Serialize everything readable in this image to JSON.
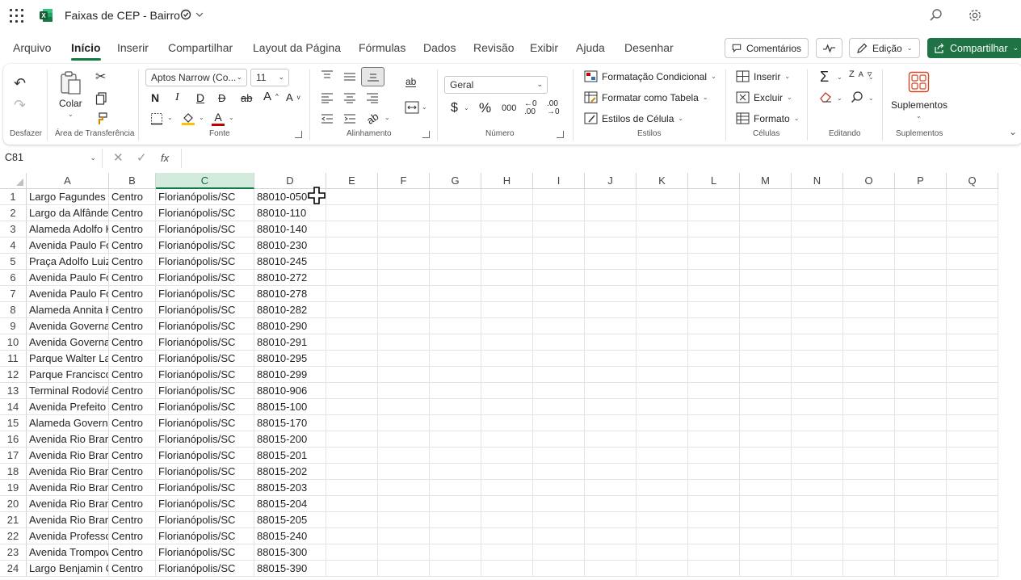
{
  "title_bar": {
    "doc_title": "Faixas de CEP - Bairro",
    "icons": [
      "app-launcher-icon",
      "excel-logo-icon",
      "autosave-icon",
      "chevron-down-icon",
      "search-icon",
      "gear-icon"
    ]
  },
  "menu": {
    "tabs": [
      "Arquivo",
      "Início",
      "Inserir",
      "Compartilhar",
      "Layout da Página",
      "Fórmulas",
      "Dados",
      "Revisão",
      "Exibir",
      "Ajuda",
      "Desenhar"
    ],
    "active_tab": "Início",
    "comments_label": "Comentários",
    "editing_label": "Edição",
    "share_label": "Compartilhar",
    "accent_color": "#107c41",
    "share_color": "#1f7244"
  },
  "ribbon": {
    "undo_group_label": "Desfazer",
    "clipboard": {
      "paste_label": "Colar",
      "group_label": "Área de Transferência"
    },
    "font": {
      "name": "Aptos Narrow (Co...",
      "size": "11",
      "bold": "N",
      "italic": "I",
      "underline": "D",
      "strike": "ab",
      "grow": "A",
      "shrink": "A",
      "font_color_letter": "A",
      "group_label": "Fonte"
    },
    "alignment": {
      "group_label": "Alinhamento"
    },
    "number": {
      "format": "Geral",
      "currency": "$",
      "percent": "%",
      "thousands": "000",
      "group_label": "Número"
    },
    "styles": {
      "conditional": "Formatação Condicional",
      "table": "Formatar como Tabela",
      "cell_styles": "Estilos de Célula",
      "group_label": "Estilos"
    },
    "cells": {
      "insert": "Inserir",
      "delete": "Excluir",
      "format": "Formato",
      "group_label": "Células"
    },
    "editing": {
      "group_label": "Editando"
    },
    "addins": {
      "button_label": "Suplementos",
      "group_label": "Suplementos"
    }
  },
  "formula_bar": {
    "name_box": "C81",
    "fx_label": "fx",
    "formula": ""
  },
  "grid": {
    "columns": [
      "A",
      "B",
      "C",
      "D",
      "E",
      "F",
      "G",
      "H",
      "I",
      "J",
      "K",
      "L",
      "M",
      "N",
      "O",
      "P",
      "Q"
    ],
    "selected_column": "C",
    "rows": [
      {
        "n": "1",
        "a": "Largo Fagundes",
        "b": "Centro",
        "c": "Florianópolis/SC",
        "d": "88010-050"
      },
      {
        "n": "2",
        "a": "Largo da Alfândega",
        "b": "Centro",
        "c": "Florianópolis/SC",
        "d": "88010-110"
      },
      {
        "n": "3",
        "a": "Alameda Adolfo Konder",
        "b": "Centro",
        "c": "Florianópolis/SC",
        "d": "88010-140"
      },
      {
        "n": "4",
        "a": "Avenida Paulo Fontes",
        "b": "Centro",
        "c": "Florianópolis/SC",
        "d": "88010-230"
      },
      {
        "n": "5",
        "a": "Praça Adolfo Luiz",
        "b": "Centro",
        "c": "Florianópolis/SC",
        "d": "88010-245"
      },
      {
        "n": "6",
        "a": "Avenida Paulo Fontes",
        "b": "Centro",
        "c": "Florianópolis/SC",
        "d": "88010-272"
      },
      {
        "n": "7",
        "a": "Avenida Paulo Fontes",
        "b": "Centro",
        "c": "Florianópolis/SC",
        "d": "88010-278"
      },
      {
        "n": "8",
        "a": "Alameda Annita Konder",
        "b": "Centro",
        "c": "Florianópolis/SC",
        "d": "88010-282"
      },
      {
        "n": "9",
        "a": "Avenida Governador",
        "b": "Centro",
        "c": "Florianópolis/SC",
        "d": "88010-290"
      },
      {
        "n": "10",
        "a": "Avenida Governador",
        "b": "Centro",
        "c": "Florianópolis/SC",
        "d": "88010-291"
      },
      {
        "n": "11",
        "a": "Parque Walter Lange",
        "b": "Centro",
        "c": "Florianópolis/SC",
        "d": "88010-295"
      },
      {
        "n": "12",
        "a": "Parque Francisco",
        "b": "Centro",
        "c": "Florianópolis/SC",
        "d": "88010-299"
      },
      {
        "n": "13",
        "a": "Terminal Rodoviário",
        "b": "Centro",
        "c": "Florianópolis/SC",
        "d": "88010-906"
      },
      {
        "n": "14",
        "a": "Avenida Prefeito Osmar",
        "b": "Centro",
        "c": "Florianópolis/SC",
        "d": "88015-100"
      },
      {
        "n": "15",
        "a": "Alameda Governador",
        "b": "Centro",
        "c": "Florianópolis/SC",
        "d": "88015-170"
      },
      {
        "n": "16",
        "a": "Avenida Rio Branco",
        "b": "Centro",
        "c": "Florianópolis/SC",
        "d": "88015-200"
      },
      {
        "n": "17",
        "a": "Avenida Rio Branco",
        "b": "Centro",
        "c": "Florianópolis/SC",
        "d": "88015-201"
      },
      {
        "n": "18",
        "a": "Avenida Rio Branco",
        "b": "Centro",
        "c": "Florianópolis/SC",
        "d": "88015-202"
      },
      {
        "n": "19",
        "a": "Avenida Rio Branco",
        "b": "Centro",
        "c": "Florianópolis/SC",
        "d": "88015-203"
      },
      {
        "n": "20",
        "a": "Avenida Rio Branco",
        "b": "Centro",
        "c": "Florianópolis/SC",
        "d": "88015-204"
      },
      {
        "n": "21",
        "a": "Avenida Rio Branco",
        "b": "Centro",
        "c": "Florianópolis/SC",
        "d": "88015-205"
      },
      {
        "n": "22",
        "a": "Avenida Professor",
        "b": "Centro",
        "c": "Florianópolis/SC",
        "d": "88015-240"
      },
      {
        "n": "23",
        "a": "Avenida Trompowsky",
        "b": "Centro",
        "c": "Florianópolis/SC",
        "d": "88015-300"
      },
      {
        "n": "24",
        "a": "Largo Benjamin Constant",
        "b": "Centro",
        "c": "Florianópolis/SC",
        "d": "88015-390"
      }
    ]
  }
}
